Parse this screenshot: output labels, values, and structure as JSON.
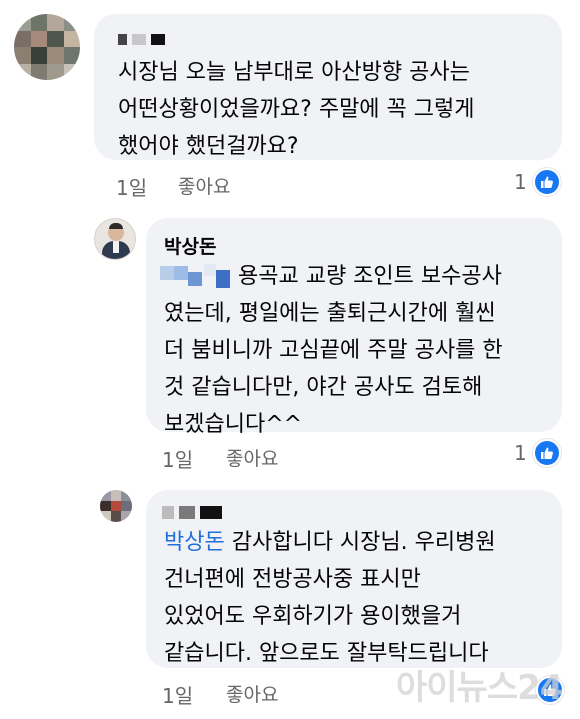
{
  "comments": [
    {
      "author": "",
      "text_lines": [
        "시장님 오늘 남부대로 아산방향 공사는",
        "어떤상황이었을까요? 주말에  꼭 그렇게",
        "했어야 했던걸까요?"
      ],
      "time": "1일",
      "like_label": "좋아요",
      "reaction_count": "1"
    },
    {
      "author": "박상돈",
      "text_lines": [
        "용곡교 교량 조인트 보수공사",
        "였는데, 평일에는 출퇴근시간에 훨씬",
        "더 붐비니까 고심끝에 주말 공사를 한",
        "것 같습니다만, 야간 공사도 검토해",
        "보겠습니다^^"
      ],
      "time": "1일",
      "like_label": "좋아요",
      "reaction_count": "1"
    },
    {
      "author": "",
      "mention": "박상돈",
      "text_lines": [
        " 감사합니다 시장님. 우리병원",
        "건너편에 전방공사중 표시만",
        "있었어도 우회하기가 용이했을거",
        "같습니다. 앞으로도 잘부탁드립니다"
      ],
      "time": "1일",
      "like_label": "좋아요"
    }
  ],
  "watermark": "아이뉴스24",
  "icons": {
    "like_reaction": "thumbs-up-icon"
  },
  "colors": {
    "bubble_bg": "#f0f2f5",
    "mention": "#216fdb",
    "meta_text": "#65676b",
    "like_blue": "#1877f2"
  }
}
